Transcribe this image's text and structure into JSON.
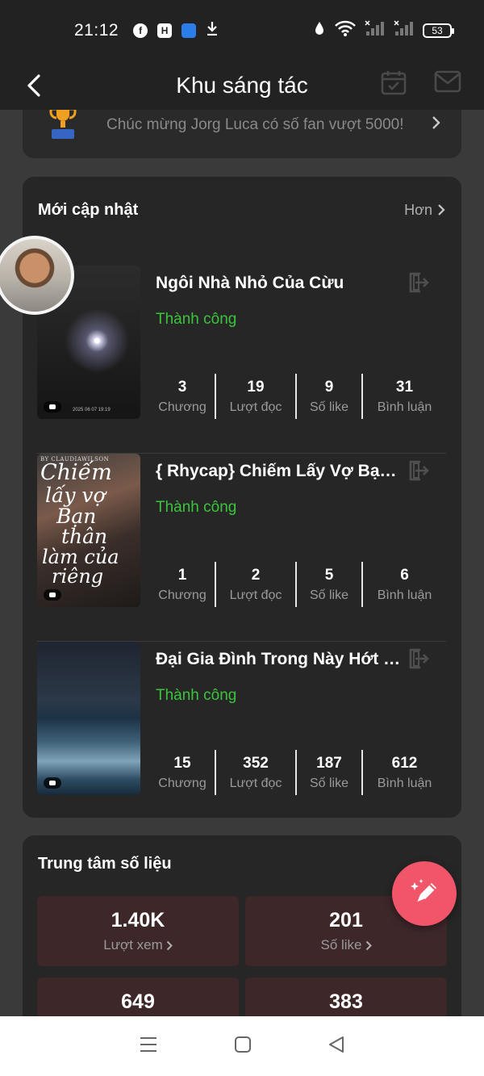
{
  "status_bar": {
    "time": "21:12",
    "battery": "53",
    "app_icons": [
      "facebook-icon",
      "hashnode-icon",
      "blue-app-icon",
      "download-icon"
    ],
    "right_icons": [
      "data-saver-icon",
      "wifi-icon",
      "signal-1-icon",
      "signal-2-icon"
    ]
  },
  "header": {
    "title": "Khu sáng tác",
    "back_icon": "chevron-left-icon",
    "calendar_icon": "calendar-check-icon",
    "mail_icon": "mail-icon"
  },
  "notice": {
    "text": "Chúc mừng Jorg Luca có số fan vượt 5000!",
    "icon": "trophy-icon"
  },
  "updates": {
    "title": "Mới cập nhật",
    "more_label": "Hơn",
    "books": [
      {
        "title": "Ngôi Nhà Nhỏ Của Cừu",
        "status": "Thành công",
        "stats": [
          {
            "value": "3",
            "label": "Chương"
          },
          {
            "value": "19",
            "label": "Lượt đọc"
          },
          {
            "value": "9",
            "label": "Số like"
          },
          {
            "value": "31",
            "label": "Bình luận"
          }
        ],
        "cover_caption": "2025 06 07 19:19"
      },
      {
        "title": "{ Rhycap} Chiếm Lấy Vợ Bạn Thân Làm Của Riêng",
        "status": "Thành công",
        "stats": [
          {
            "value": "1",
            "label": "Chương"
          },
          {
            "value": "2",
            "label": "Lượt đọc"
          },
          {
            "value": "5",
            "label": "Số like"
          },
          {
            "value": "6",
            "label": "Bình luận"
          }
        ],
        "cover_caption": "BY CLAUDIAWILSON",
        "cover_lines": [
          "Chiếm",
          "lấy vợ",
          "Bạn",
          "thân",
          "làm của",
          "riêng"
        ]
      },
      {
        "title": "Đại Gia Đình Trong Này Hớt Hải",
        "status": "Thành công",
        "stats": [
          {
            "value": "15",
            "label": "Chương"
          },
          {
            "value": "352",
            "label": "Lượt đọc"
          },
          {
            "value": "187",
            "label": "Số like"
          },
          {
            "value": "612",
            "label": "Bình luận"
          }
        ]
      }
    ]
  },
  "data_center": {
    "title": "Trung tâm số liệu",
    "tiles": [
      {
        "value": "1.40K",
        "label": "Lượt xem"
      },
      {
        "value": "201",
        "label": "Số like"
      },
      {
        "value": "649",
        "label": ""
      },
      {
        "value": "383",
        "label": ""
      }
    ]
  },
  "fab": {
    "icon": "pencil-sparkle-icon"
  },
  "nav_bar": {
    "icons": [
      "menu-icon",
      "home-square-icon",
      "back-triangle-icon"
    ]
  },
  "colors": {
    "success": "#3cc43c",
    "accent": "#f0556a",
    "tile_bg": "#3d2729",
    "card_bg": "#262626"
  }
}
